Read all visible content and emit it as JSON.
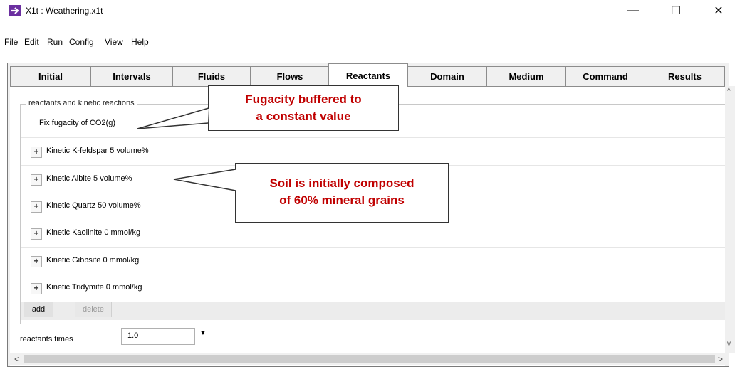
{
  "window": {
    "title": "X1t : Weathering.x1t",
    "minimize": "—",
    "maximize": "☐",
    "close": "✕"
  },
  "menu": [
    "File",
    "Edit",
    "Run",
    "Config",
    "View",
    "Help"
  ],
  "tabs": [
    "Initial",
    "Intervals",
    "Fluids",
    "Flows",
    "Reactants",
    "Domain",
    "Medium",
    "Command",
    "Results"
  ],
  "active_tab": "Reactants",
  "group_title": "reactants and kinetic reactions",
  "reactants": [
    {
      "label": "Fix fugacity of CO2(g)",
      "expandable": false
    },
    {
      "label": "Kinetic K-feldspar 5 volume%",
      "expandable": true
    },
    {
      "label": "Kinetic Albite 5 volume%",
      "expandable": true
    },
    {
      "label": "Kinetic Quartz 50 volume%",
      "expandable": true
    },
    {
      "label": "Kinetic Kaolinite 0 mmol/kg",
      "expandable": true
    },
    {
      "label": "Kinetic Gibbsite 0 mmol/kg",
      "expandable": true
    },
    {
      "label": "Kinetic Tridymite 0 mmol/kg",
      "expandable": true
    }
  ],
  "buttons": {
    "add": "add",
    "delete": "delete",
    "plus": "+"
  },
  "reactants_times": {
    "label": "reactants times",
    "value": "1.0"
  },
  "callouts": [
    {
      "line1": "Fugacity buffered to",
      "line2": "a constant value"
    },
    {
      "line1": "Soil is initially composed",
      "line2": "of 60% mineral grains"
    }
  ],
  "colors": {
    "callout_text": "#c00000",
    "app_icon": "#6b2fa0"
  }
}
